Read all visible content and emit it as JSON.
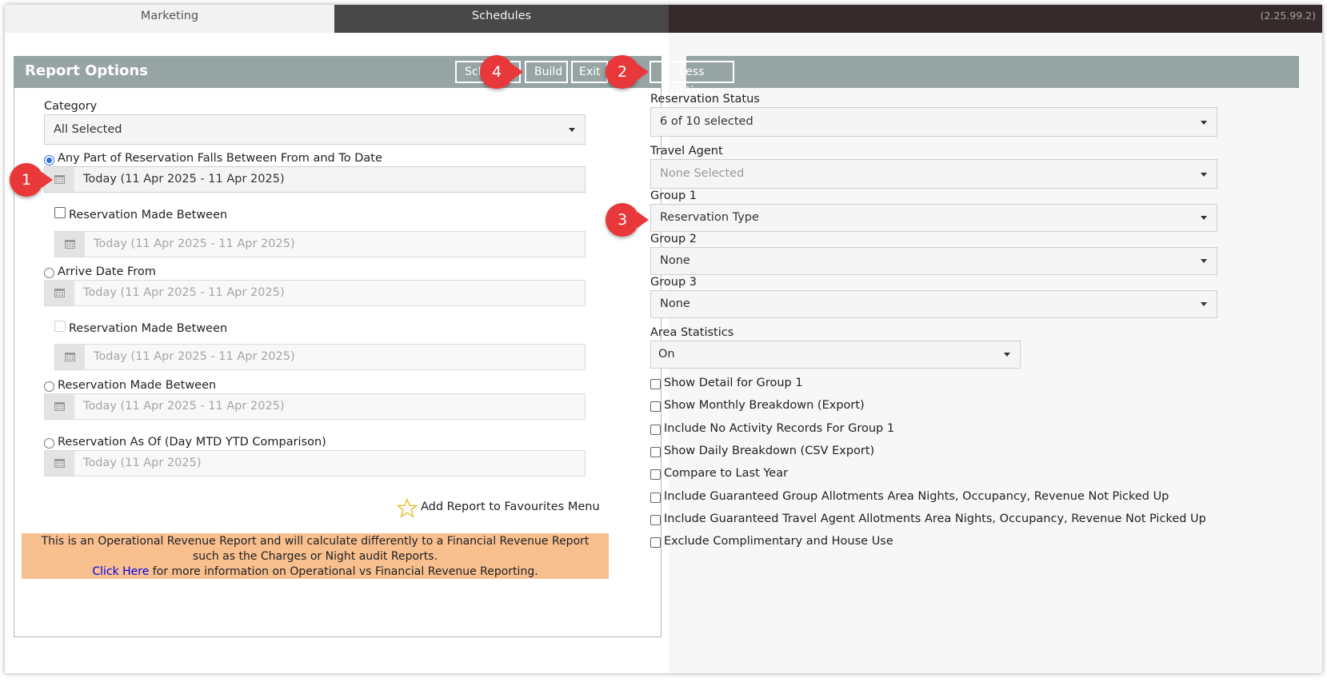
{
  "tabs": {
    "marketing": "Marketing",
    "schedules": "Schedules"
  },
  "version": "(2.25.99.2)",
  "report_options": {
    "title": "Report Options",
    "buttons": {
      "schedule": "Schedule",
      "build": "Build",
      "exit": "Exit",
      "less_options": "Less Options"
    }
  },
  "left": {
    "category_label": "Category",
    "category_value": "All Selected",
    "any_part_label": "Any Part of Reservation Falls Between From and To Date",
    "any_part_date": "Today (11 Apr 2025 - 11 Apr 2025)",
    "made_between_1_label": "Reservation Made Between",
    "made_between_1_date": "Today (11 Apr 2025 - 11 Apr 2025)",
    "arrive_label": "Arrive Date From",
    "arrive_date": "Today (11 Apr 2025 - 11 Apr 2025)",
    "made_between_2_label": "Reservation Made Between",
    "made_between_2_date": "Today (11 Apr 2025 - 11 Apr 2025)",
    "made_between_3_label": "Reservation Made Between",
    "made_between_3_date": "Today (11 Apr 2025 - 11 Apr 2025)",
    "as_of_label": "Reservation As Of (Day MTD YTD Comparison)",
    "as_of_date": "Today (11 Apr 2025)",
    "favourites": "Add Report to Favourites Menu",
    "notice_line1": "This is an Operational Revenue Report and will calculate differently to a Financial Revenue Report",
    "notice_line2": "such as the Charges or Night audit Reports.",
    "notice_link": "Click Here",
    "notice_line3": " for more information on Operational vs Financial Revenue Reporting."
  },
  "right": {
    "reservation_status_label": "Reservation Status",
    "reservation_status_value": "6 of 10 selected",
    "travel_agent_label": "Travel Agent",
    "travel_agent_value": "None Selected",
    "group1_label": "Group 1",
    "group1_value": "Reservation Type",
    "group2_label": "Group 2",
    "group2_value": "None",
    "group3_label": "Group 3",
    "group3_value": "None",
    "area_stats_label": "Area Statistics",
    "area_stats_value": "On",
    "checkboxes": [
      "Show Detail for Group 1",
      "Show Monthly Breakdown (Export)",
      "Include No Activity Records For Group 1",
      "Show Daily Breakdown (CSV Export)",
      "Compare to Last Year",
      "Include Guaranteed Group Allotments Area Nights, Occupancy, Revenue Not Picked Up",
      "Include Guaranteed Travel Agent Allotments Area Nights, Occupancy, Revenue Not Picked Up",
      "Exclude Complimentary and House Use"
    ]
  },
  "markers": {
    "m1": "1",
    "m2": "2",
    "m3": "3",
    "m4": "4"
  },
  "colors": {
    "header": "#96a4a4",
    "topbar": "#342a2c",
    "marker": "#e8383a",
    "notice": "#f8bf8f"
  }
}
